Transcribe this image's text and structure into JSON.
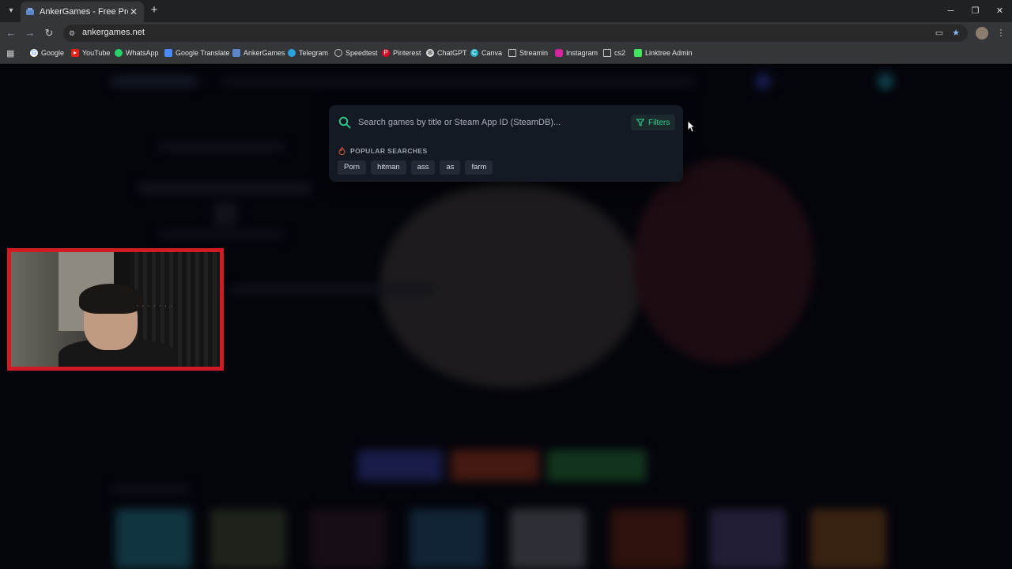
{
  "browser": {
    "tab_title": "AnkerGames - Free Pre-installed",
    "url": "ankergames.net",
    "bookmarks": [
      "Google",
      "YouTube",
      "WhatsApp",
      "Google Translate",
      "AnkerGames",
      "Telegram",
      "Speedtest",
      "Pinterest",
      "ChatGPT",
      "Canva",
      "Streamin",
      "Instagram",
      "cs2",
      "Linktree Admin"
    ]
  },
  "search": {
    "placeholder": "Search games by title or Steam App ID (SteamDB)...",
    "filters_label": "Filters",
    "popular_heading": "POPULAR SEARCHES",
    "popular": [
      "Porn",
      "hitman",
      "ass",
      "as",
      "farm"
    ]
  },
  "colors": {
    "accent": "#2fd28f",
    "webcam_border": "#d11a22",
    "fire_icon": "#e0553a"
  },
  "icons": {
    "search": "search-icon",
    "filters": "filter-funnel-icon",
    "popular": "fire-icon"
  }
}
